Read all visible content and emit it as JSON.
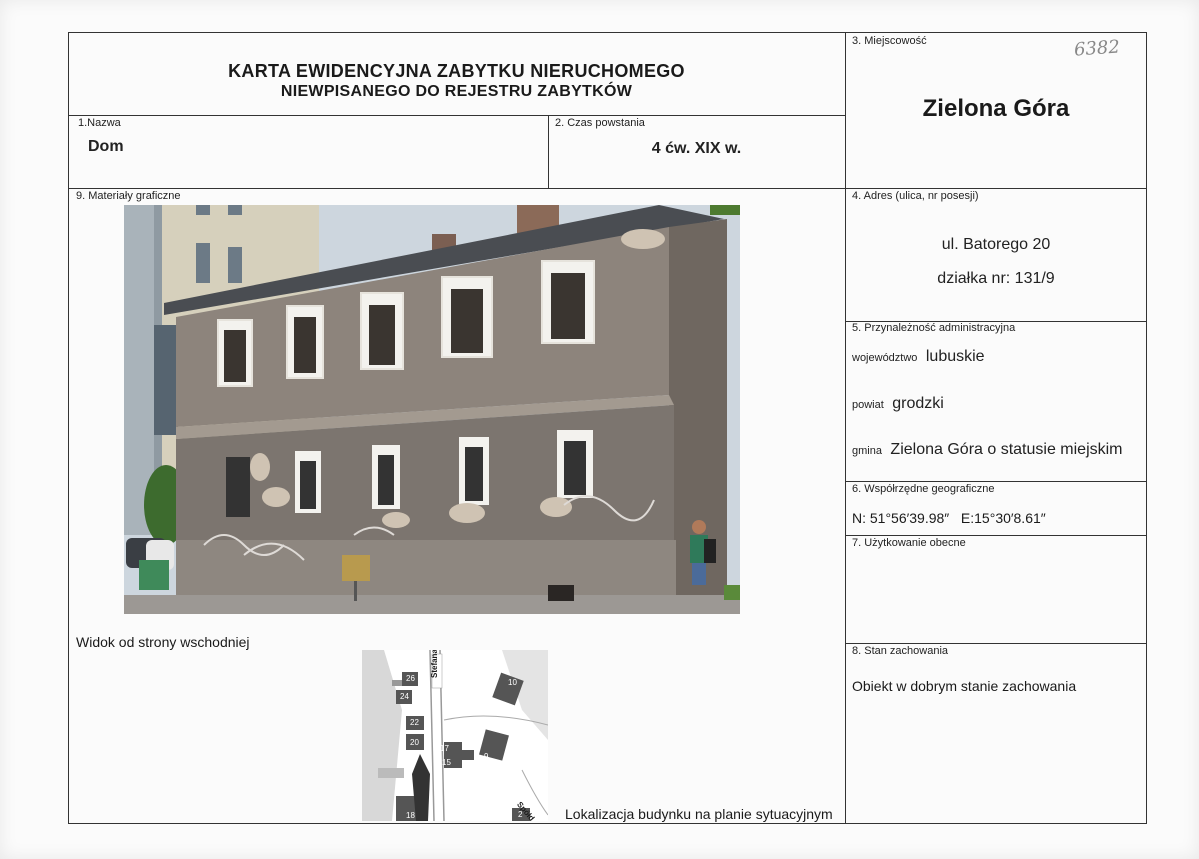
{
  "header": {
    "title_line1": "KARTA EWIDENCYJNA ZABYTKU NIERUCHOMEGO",
    "title_line2": "NIEWPISANEGO DO REJESTRU ZABYTKÓW",
    "handwritten_number": "6382"
  },
  "field_1": {
    "label": "1.Nazwa",
    "value": "Dom"
  },
  "field_2": {
    "label": "2. Czas powstania",
    "value": "4 ćw. XIX w."
  },
  "field_3": {
    "label": "3. Miejscowość",
    "value": "Zielona Góra"
  },
  "field_4": {
    "label": "4. Adres (ulica, nr posesji)",
    "address": "ul. Batorego 20",
    "parcel": "działka nr: 131/9"
  },
  "field_5": {
    "label": "5. Przynależność administracyjna",
    "voivodeship_label": "województwo",
    "voivodeship": "lubuskie",
    "county_label": "powiat",
    "county": "grodzki",
    "commune_label": "gmina",
    "commune": "Zielona Góra o statusie miejskim"
  },
  "field_6": {
    "label": "6. Współrzędne geograficzne",
    "value": "N: 51°56′39.98″   E:15°30′8.61″"
  },
  "field_7": {
    "label": "7. Użytkowanie obecne",
    "value": ""
  },
  "field_8": {
    "label": "8. Stan zachowania",
    "value": "Obiekt w dobrym stanie zachowania"
  },
  "field_9": {
    "label": "9. Materiały graficzne",
    "photo_caption": "Widok od strony wschodniej",
    "map_caption": "Lokalizacja budynku na planie sytuacyjnym"
  },
  "map": {
    "street_label_1": "Stefana B",
    "street_label_2": "Spółd",
    "building_numbers": [
      "26",
      "24",
      "22",
      "20",
      "17",
      "15",
      "9",
      "10",
      "18",
      "2"
    ]
  }
}
